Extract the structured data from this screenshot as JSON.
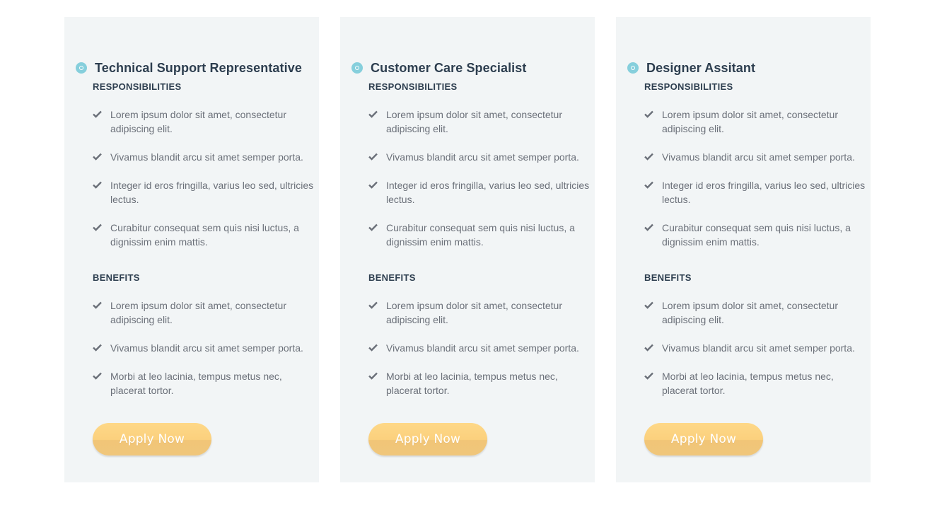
{
  "colors": {
    "card_background": "#f2f5f6",
    "title": "#2d3e4f",
    "body_text": "#6b7079",
    "icon_accent": "#86cfdc",
    "button": "#fcd27f",
    "check": "#6b7079"
  },
  "icons": {
    "title_bullet": "circle-bullet-icon",
    "list_marker": "checkmark-icon"
  },
  "cards": [
    {
      "title": "Technical Support Representative",
      "responsibilities_label": "RESPONSIBILITIES",
      "responsibilities": [
        "Lorem ipsum dolor sit amet, consectetur adipiscing elit.",
        "Vivamus blandit arcu sit amet semper porta.",
        "Integer id eros fringilla, varius leo sed, ultricies lectus.",
        "Curabitur consequat sem quis nisi luctus, a dignissim enim mattis."
      ],
      "benefits_label": "BENEFITS",
      "benefits": [
        "Lorem ipsum dolor sit amet, consectetur adipiscing elit.",
        "Vivamus blandit arcu sit amet semper porta.",
        "Morbi at leo lacinia, tempus metus nec, placerat tortor."
      ],
      "button_label": "Apply Now"
    },
    {
      "title": "Customer Care Specialist",
      "responsibilities_label": "RESPONSIBILITIES",
      "responsibilities": [
        "Lorem ipsum dolor sit amet, consectetur adipiscing elit.",
        "Vivamus blandit arcu sit amet semper porta.",
        "Integer id eros fringilla, varius leo sed, ultricies lectus.",
        "Curabitur consequat sem quis nisi luctus, a dignissim enim mattis."
      ],
      "benefits_label": "BENEFITS",
      "benefits": [
        "Lorem ipsum dolor sit amet, consectetur adipiscing elit.",
        "Vivamus blandit arcu sit amet semper porta.",
        "Morbi at leo lacinia, tempus metus nec, placerat tortor."
      ],
      "button_label": "Apply Now"
    },
    {
      "title": "Designer Assitant",
      "responsibilities_label": "RESPONSIBILITIES",
      "responsibilities": [
        "Lorem ipsum dolor sit amet, consectetur adipiscing elit.",
        "Vivamus blandit arcu sit amet semper porta.",
        "Integer id eros fringilla, varius leo sed, ultricies lectus.",
        "Curabitur consequat sem quis nisi luctus, a dignissim enim mattis."
      ],
      "benefits_label": "BENEFITS",
      "benefits": [
        "Lorem ipsum dolor sit amet, consectetur adipiscing elit.",
        "Vivamus blandit arcu sit amet semper porta.",
        "Morbi at leo lacinia, tempus metus nec, placerat tortor."
      ],
      "button_label": "Apply Now"
    }
  ]
}
